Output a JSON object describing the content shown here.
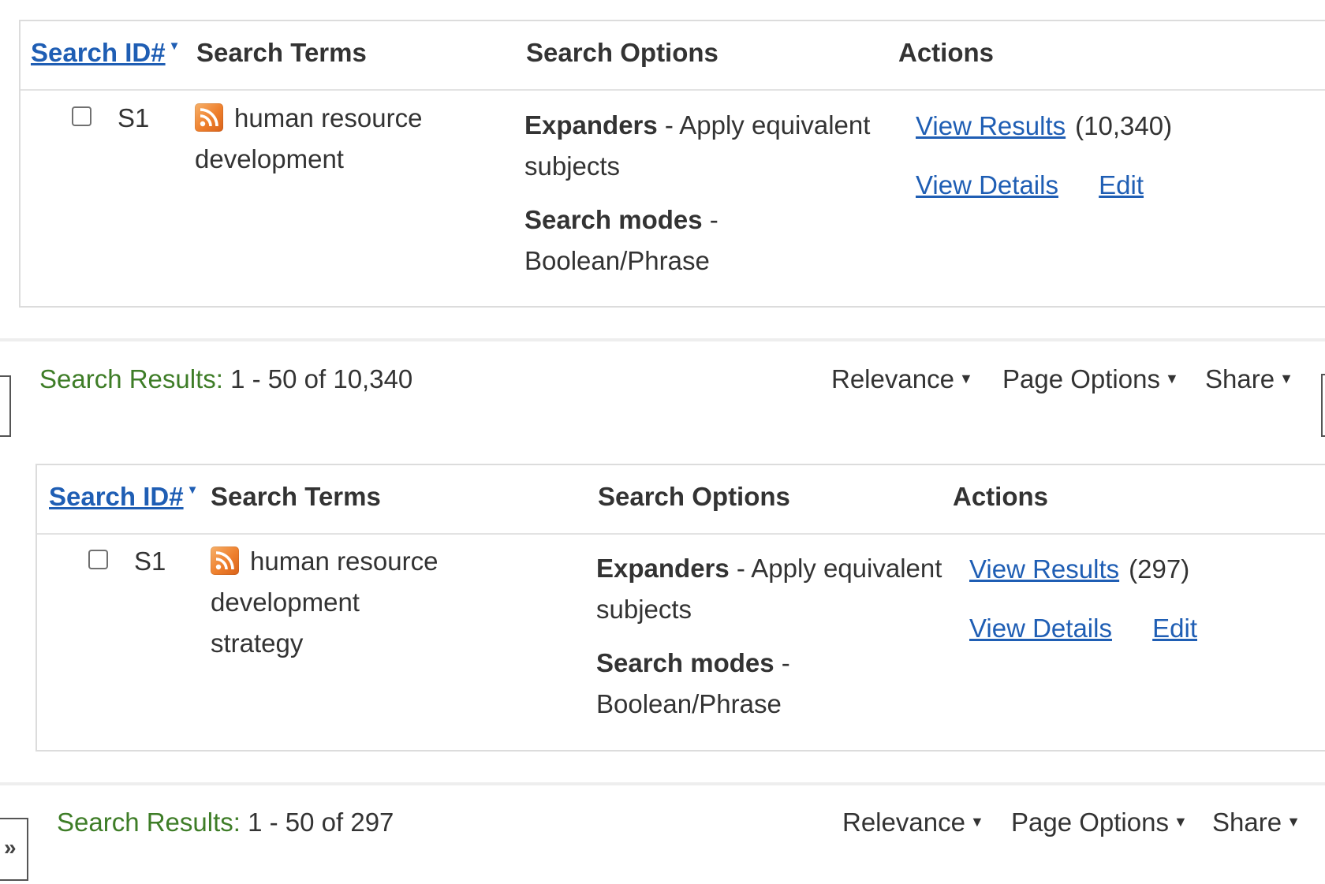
{
  "columns": {
    "search_id": "Search ID#",
    "search_terms": "Search Terms",
    "search_options": "Search Options",
    "actions": "Actions"
  },
  "sections": [
    {
      "history_row": {
        "id": "S1",
        "terms_line1": "human resource",
        "terms_line2": "development",
        "expanders_label": "Expanders",
        "expanders_value": "- Apply equivalent",
        "expanders_value2": "subjects",
        "modes_label": "Search modes",
        "modes_dash": "-",
        "modes_value": "Boolean/Phrase",
        "view_results": "View Results",
        "count": "(10,340)",
        "view_details": "View Details",
        "edit": "Edit"
      },
      "results_bar": {
        "label": "Search Results:",
        "range": "1 - 50 of 10,340",
        "sort": "Relevance",
        "page_options": "Page Options",
        "share": "Share"
      }
    },
    {
      "history_row": {
        "id": "S1",
        "terms_line1": "human resource development",
        "terms_line2": "strategy",
        "expanders_label": "Expanders",
        "expanders_value": "- Apply equivalent",
        "expanders_value2": "subjects",
        "modes_label": "Search modes",
        "modes_dash": "-",
        "modes_value": "Boolean/Phrase",
        "view_results": "View Results",
        "count": "(297)",
        "view_details": "View Details",
        "edit": "Edit"
      },
      "results_bar": {
        "label": "Search Results:",
        "range": "1 - 50 of 297",
        "sort": "Relevance",
        "page_options": "Page Options",
        "share": "Share"
      }
    }
  ],
  "icons": {
    "sort_caret": "▼",
    "dropdown_caret": "▼",
    "expand_panel": "»",
    "rss": "rss-feed-icon"
  },
  "colors": {
    "link": "#1f5eb4",
    "results_label": "#3e7d27",
    "rss": "#ee7f2d"
  }
}
